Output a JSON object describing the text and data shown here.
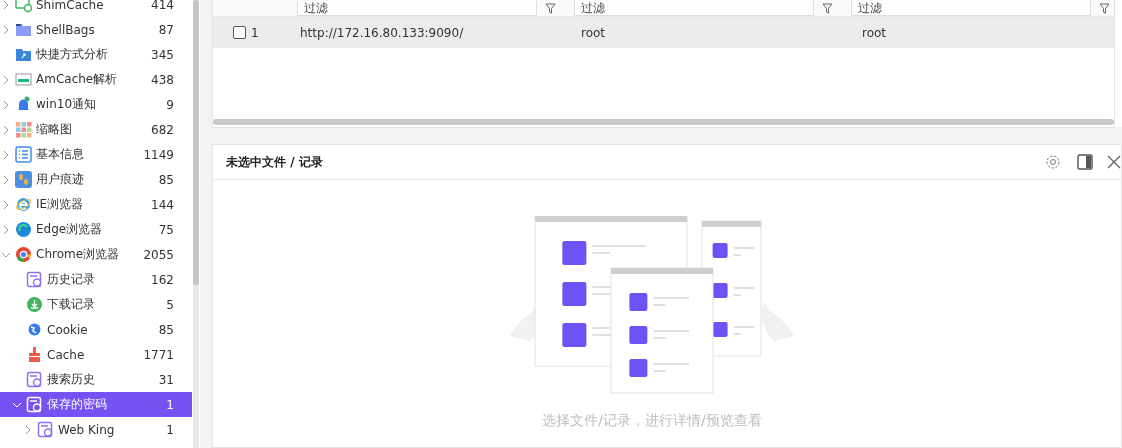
{
  "sidebar": {
    "items": [
      {
        "label": "ShimCache",
        "count": "414",
        "kind": "cache",
        "expanded": false,
        "selected": false
      },
      {
        "label": "ShellBags",
        "count": "87",
        "kind": "folder",
        "expanded": false,
        "selected": false
      },
      {
        "label": "快捷方式分析",
        "count": "345",
        "kind": "shortcut",
        "selected": false
      },
      {
        "label": "AmCache解析",
        "count": "438",
        "kind": "window",
        "expanded": false,
        "selected": false
      },
      {
        "label": "win10通知",
        "count": "9",
        "kind": "bell",
        "expanded": false,
        "selected": false
      },
      {
        "label": "缩略图",
        "count": "682",
        "kind": "grid",
        "expanded": false,
        "selected": false
      },
      {
        "label": "基本信息",
        "count": "1149",
        "kind": "list",
        "expanded": false,
        "selected": false
      },
      {
        "label": "用户痕迹",
        "count": "85",
        "kind": "footprints",
        "expanded": false,
        "selected": false
      },
      {
        "label": "IE浏览器",
        "count": "144",
        "kind": "ie",
        "expanded": false,
        "selected": false
      },
      {
        "label": "Edge浏览器",
        "count": "75",
        "kind": "edge",
        "expanded": false,
        "selected": false
      },
      {
        "label": "Chrome浏览器",
        "count": "2055",
        "kind": "chrome",
        "expanded": true,
        "selected": false,
        "children": [
          {
            "label": "历史记录",
            "count": "162",
            "kind": "history",
            "selected": false
          },
          {
            "label": "下载记录",
            "count": "5",
            "kind": "download",
            "selected": false
          },
          {
            "label": "Cookie",
            "count": "85",
            "kind": "globe",
            "selected": false
          },
          {
            "label": "Cache",
            "count": "1771",
            "kind": "broom",
            "selected": false
          },
          {
            "label": "搜索历史",
            "count": "31",
            "kind": "history",
            "selected": false
          },
          {
            "label": "保存的密码",
            "count": "1",
            "kind": "history",
            "expanded": true,
            "selected": true,
            "children": [
              {
                "label": "Web King",
                "count": "1",
                "kind": "history",
                "expanded": false,
                "selected": false
              }
            ]
          }
        ]
      }
    ]
  },
  "table": {
    "filters": [
      {
        "placeholder": "过滤"
      },
      {
        "placeholder": "过滤"
      },
      {
        "placeholder": "过滤"
      }
    ],
    "rows": [
      {
        "checked": false,
        "selected": true,
        "index": "1",
        "cells": [
          "http://172.16.80.133:9090/",
          "root",
          "root"
        ]
      }
    ]
  },
  "detail": {
    "title": "未选中文件 / 记录",
    "empty_text": "选择文件/记录，进行详情/预览查看"
  }
}
